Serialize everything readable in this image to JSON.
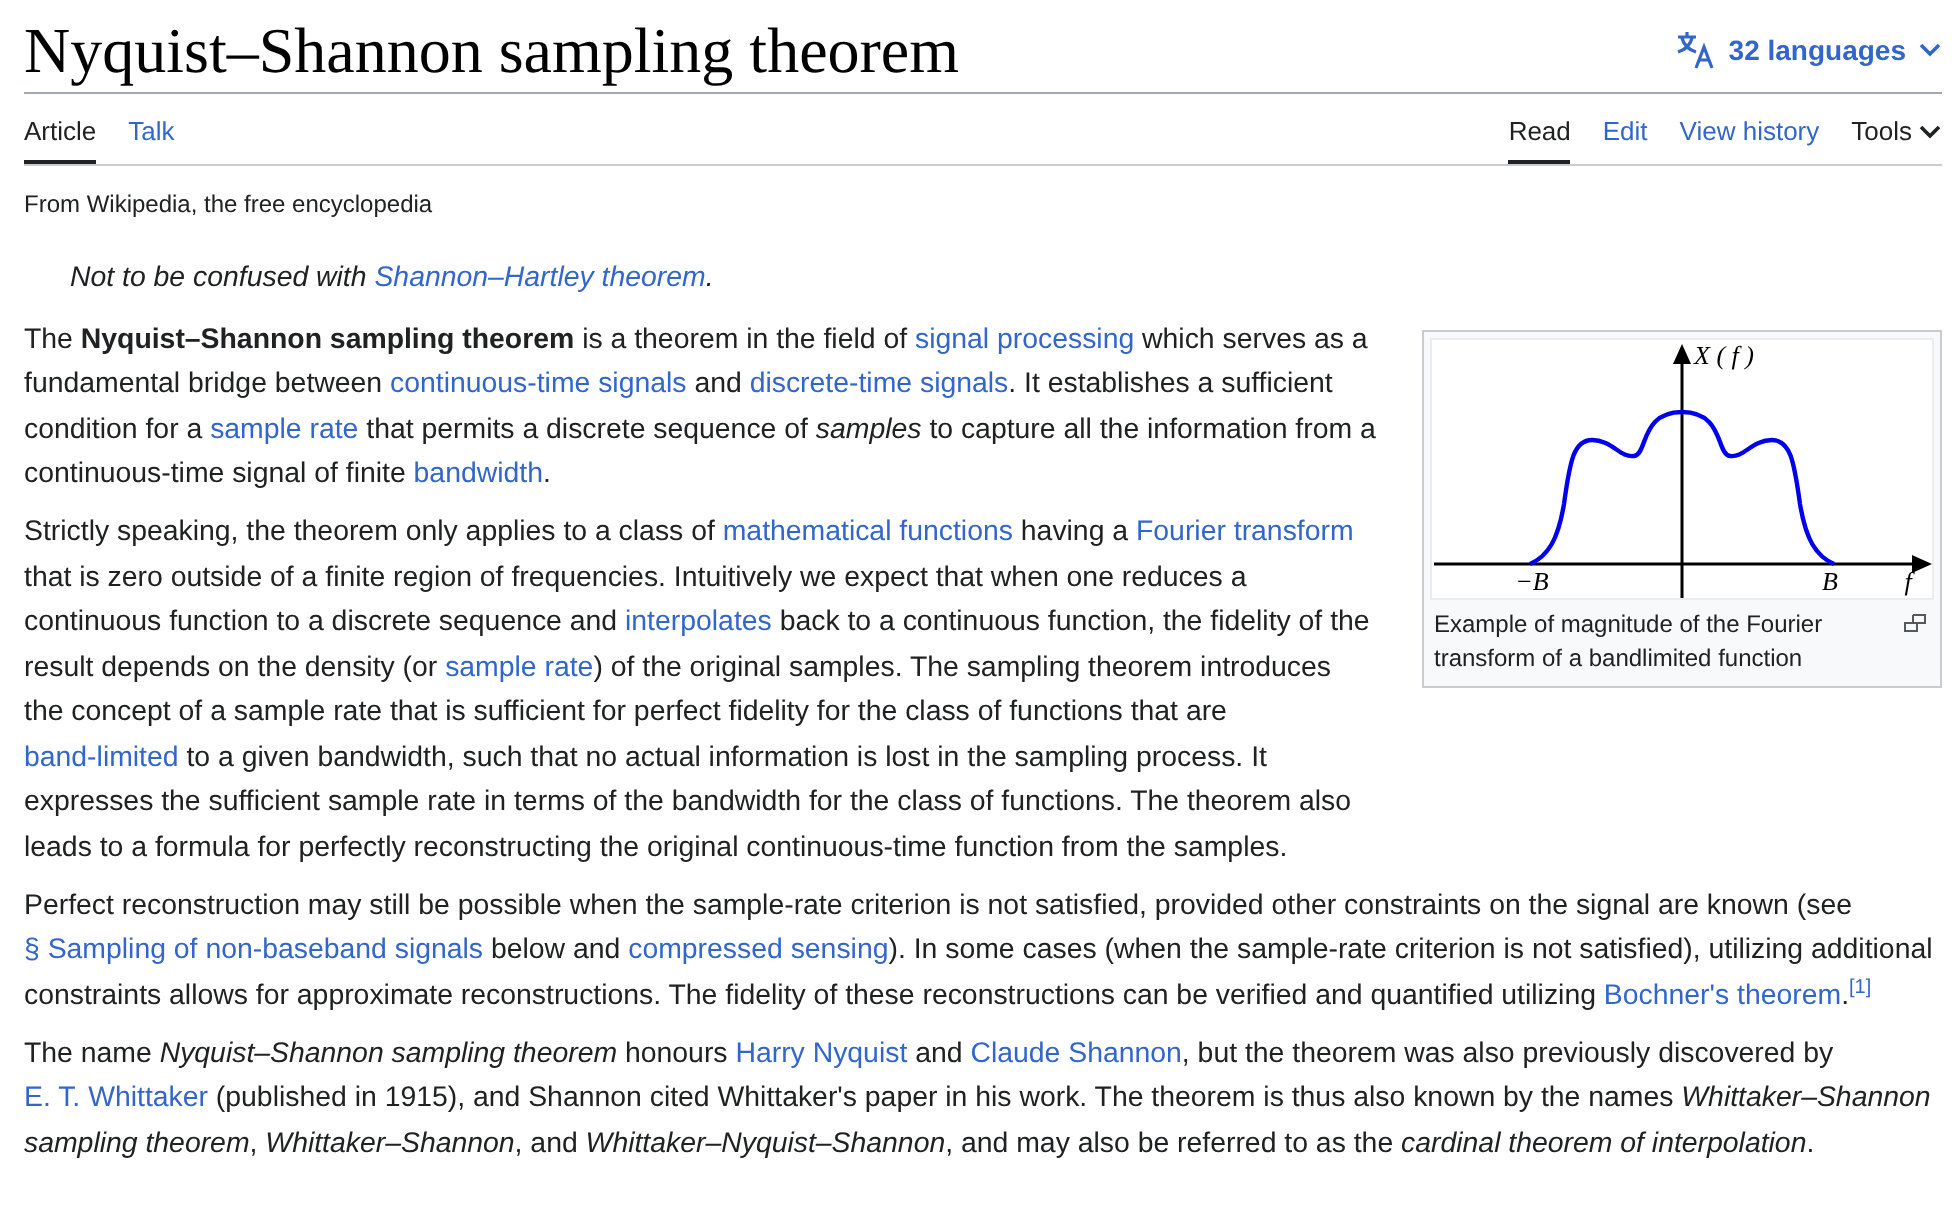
{
  "title": "Nyquist–Shannon sampling theorem",
  "languages": {
    "label": "32 languages"
  },
  "namespace_tabs": [
    {
      "label": "Article",
      "selected": true
    },
    {
      "label": "Talk",
      "selected": false
    }
  ],
  "view_tabs": [
    {
      "label": "Read",
      "selected": true
    },
    {
      "label": "Edit",
      "selected": false
    },
    {
      "label": "View history",
      "selected": false
    }
  ],
  "tools_menu": {
    "label": "Tools"
  },
  "tagline": "From Wikipedia, the free encyclopedia",
  "hatnote": [
    {
      "kind": "text",
      "text": "Not to be confused with "
    },
    {
      "kind": "link",
      "text": "Shannon–Hartley theorem"
    },
    {
      "kind": "text",
      "text": "."
    }
  ],
  "figure": {
    "labels": [
      {
        "kind": "y_axis",
        "text": "X ( f )"
      },
      {
        "kind": "tick",
        "text": "−B"
      },
      {
        "kind": "tick",
        "text": "B"
      },
      {
        "kind": "x_axis",
        "text": "f"
      }
    ],
    "caption": "Example of magnitude of the Fourier transform of a bandlimited function"
  },
  "paragraphs": [
    {
      "segments": [
        {
          "kind": "text",
          "text": "The **Nyquist–Shannon sampling theorem** is a theorem in the field of "
        },
        {
          "kind": "link",
          "text": "signal processing"
        },
        {
          "kind": "text",
          "text": " which serves as a fundamental bridge between "
        },
        {
          "kind": "link",
          "text": "continuous-time signals"
        },
        {
          "kind": "text",
          "text": " and "
        },
        {
          "kind": "link",
          "text": "discrete-time signals"
        },
        {
          "kind": "text",
          "text": ". It establishes a sufficient condition for a "
        },
        {
          "kind": "link",
          "text": "sample rate"
        },
        {
          "kind": "text",
          "text": " that permits a discrete sequence of *samples* to capture all the information from a continuous-time signal of finite "
        },
        {
          "kind": "link",
          "text": "bandwidth"
        },
        {
          "kind": "text",
          "text": "."
        }
      ]
    },
    {
      "segments": [
        {
          "kind": "text",
          "text": "Strictly speaking, the theorem only applies to a class of "
        },
        {
          "kind": "link",
          "text": "mathematical functions"
        },
        {
          "kind": "text",
          "text": " having a "
        },
        {
          "kind": "link",
          "text": "Fourier transform"
        },
        {
          "kind": "text",
          "text": " that is zero outside of a finite region of frequencies. Intuitively we expect that when one reduces a continuous function to a discrete sequence and "
        },
        {
          "kind": "link",
          "text": "interpolates"
        },
        {
          "kind": "text",
          "text": " back to a continuous function, the fidelity of the result depends on the density (or "
        },
        {
          "kind": "link",
          "text": "sample rate"
        },
        {
          "kind": "text",
          "text": ") of the original samples. The sampling theorem introduces the concept of a sample rate that is sufficient for perfect fidelity for the class of functions that are "
        },
        {
          "kind": "link",
          "text": "band-limited"
        },
        {
          "kind": "text",
          "text": " to a given bandwidth, such that no actual information is lost in the sampling process. It expresses the sufficient sample rate in terms of the bandwidth for the class of functions. The theorem also leads to a formula for perfectly reconstructing the original continuous-time function from the samples."
        }
      ]
    },
    {
      "segments": [
        {
          "kind": "text",
          "text": "Perfect reconstruction may still be possible when the sample-rate criterion is not satisfied, provided other constraints on the signal are known (see "
        },
        {
          "kind": "link",
          "text": "§ Sampling of non-baseband signals"
        },
        {
          "kind": "text",
          "text": " below and "
        },
        {
          "kind": "link",
          "text": "compressed sensing"
        },
        {
          "kind": "text",
          "text": "). In some cases (when the sample-rate criterion is not satisfied), utilizing additional constraints allows for approximate reconstructions. The fidelity of these reconstructions can be verified and quantified utilizing "
        },
        {
          "kind": "link",
          "text": "Bochner's theorem"
        },
        {
          "kind": "text",
          "text": "."
        },
        {
          "kind": "footnote",
          "text": "[1]"
        }
      ]
    },
    {
      "segments": [
        {
          "kind": "text",
          "text": "The name *Nyquist–Shannon sampling theorem* honours "
        },
        {
          "kind": "link",
          "text": "Harry Nyquist"
        },
        {
          "kind": "text",
          "text": " and "
        },
        {
          "kind": "link",
          "text": "Claude Shannon"
        },
        {
          "kind": "text",
          "text": ", but the theorem was also previously discovered by "
        },
        {
          "kind": "link",
          "text": "E. T. Whittaker"
        },
        {
          "kind": "text",
          "text": " (published in 1915), and Shannon cited Whittaker's paper in his work. The theorem is thus also known by the names *Whittaker–Shannon sampling theorem*, *Whittaker–Shannon*, and *Whittaker–Nyquist–Shannon*, and may also be referred to as the *cardinal theorem of interpolation*."
        }
      ]
    }
  ]
}
